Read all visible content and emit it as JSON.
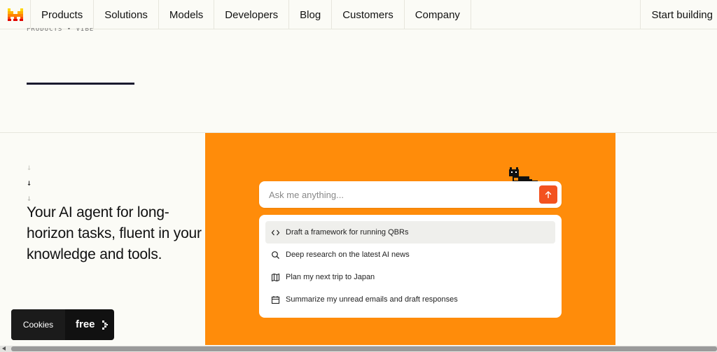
{
  "nav": {
    "items": [
      "Products",
      "Solutions",
      "Models",
      "Developers",
      "Blog",
      "Customers",
      "Company"
    ],
    "cta": "Start building"
  },
  "breadcrumb": "PRODUCTS • VIBE",
  "hero": {
    "headline": "Your AI agent for long-horizon tasks, fluent in your knowledge and tools."
  },
  "chat": {
    "placeholder": "Ask me anything...",
    "suggestions": [
      {
        "label": "Draft a framework for running QBRs",
        "icon": "code-icon"
      },
      {
        "label": "Deep research on the latest AI news",
        "icon": "search-icon"
      },
      {
        "label": "Plan my next trip to Japan",
        "icon": "map-icon"
      },
      {
        "label": "Summarize my unread emails and draft responses",
        "icon": "calendar-icon"
      }
    ]
  },
  "cookies": {
    "label": "Cookies",
    "button_fragment": "free"
  },
  "colors": {
    "panel": "#ff8c0a",
    "send_button": "#f3521f",
    "background": "#fbfbf6"
  }
}
